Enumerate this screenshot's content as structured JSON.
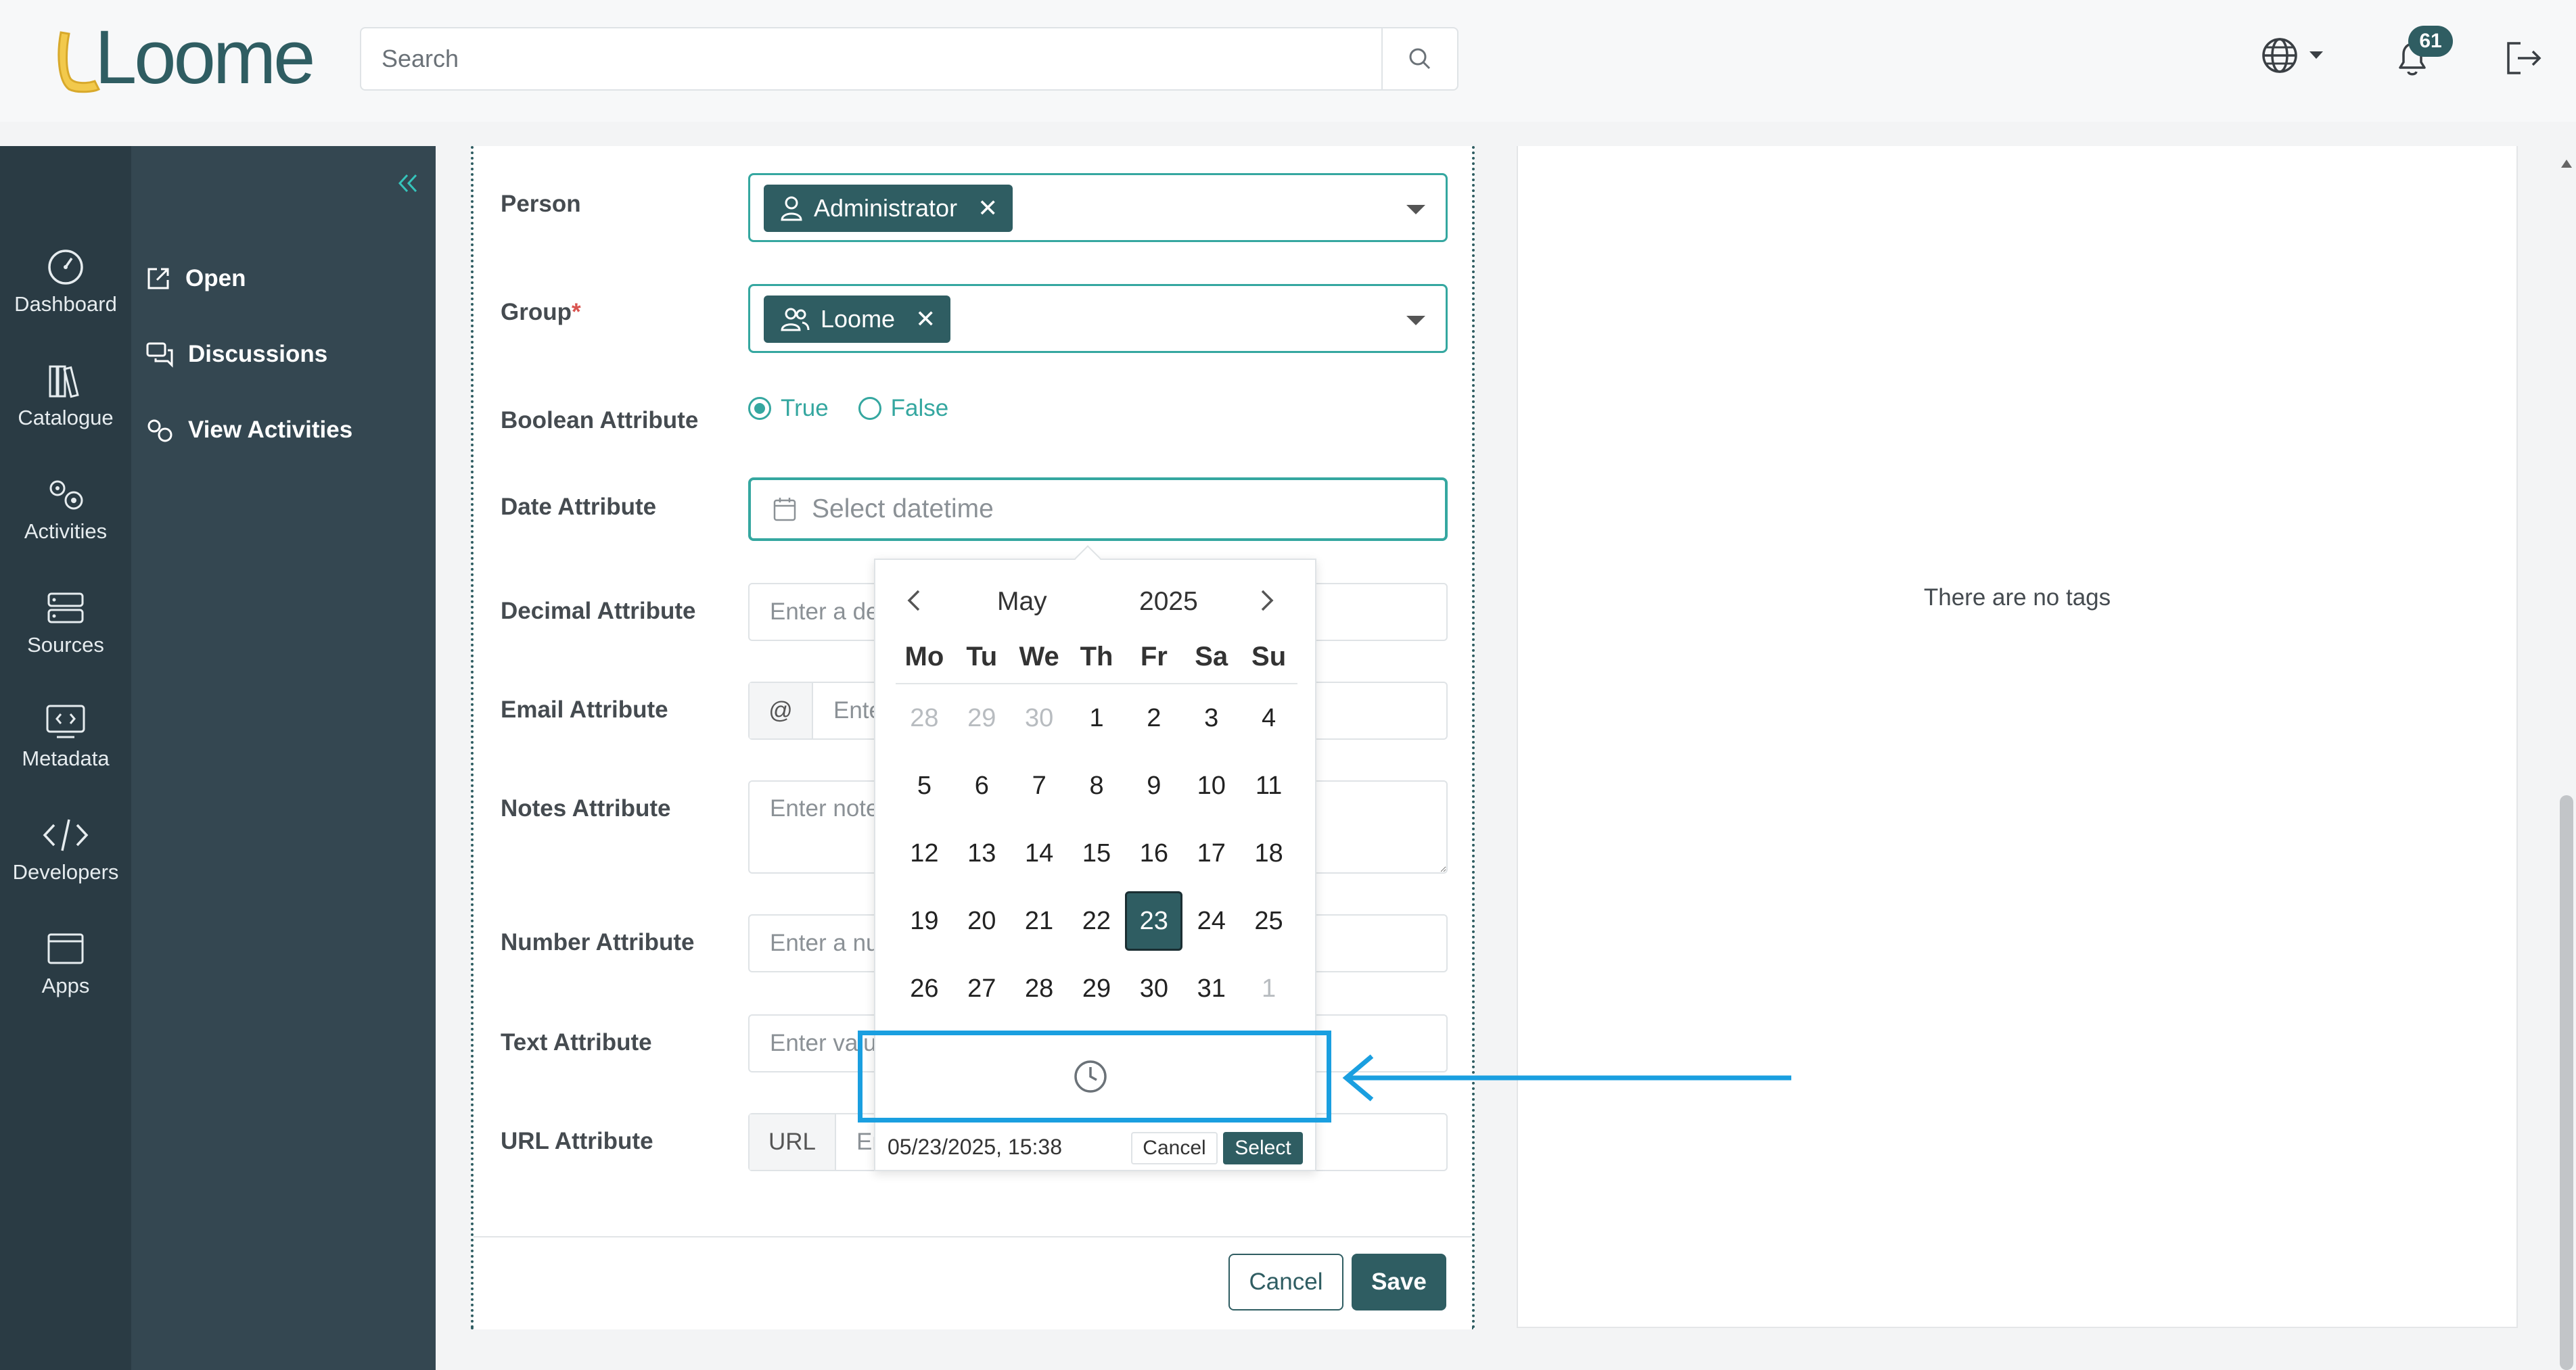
{
  "header": {
    "logo_text": "Loome",
    "search_placeholder": "Search",
    "notification_count": "61",
    "icons": {
      "search": "search-icon",
      "globe": "globe-icon",
      "bell": "bell-icon",
      "logout": "logout-icon"
    }
  },
  "rail": {
    "items": [
      {
        "label": "Dashboard",
        "icon": "dashboard-icon"
      },
      {
        "label": "Catalogue",
        "icon": "catalogue-icon"
      },
      {
        "label": "Activities",
        "icon": "activities-icon"
      },
      {
        "label": "Sources",
        "icon": "sources-icon"
      },
      {
        "label": "Metadata",
        "icon": "metadata-icon"
      },
      {
        "label": "Developers",
        "icon": "developers-icon"
      },
      {
        "label": "Apps",
        "icon": "apps-icon"
      }
    ]
  },
  "subnav": {
    "items": [
      {
        "label": "Open",
        "icon": "external-link-icon"
      },
      {
        "label": "Discussions",
        "icon": "discussions-icon"
      },
      {
        "label": "View Activities",
        "icon": "activities-icon"
      }
    ]
  },
  "form": {
    "person_label": "Person",
    "person_value": "Administrator",
    "group_label": "Group",
    "group_required": "*",
    "group_value": "Loome",
    "boolean_label": "Boolean Attribute",
    "boolean_true": "True",
    "boolean_false": "False",
    "boolean_selected": "True",
    "date_label": "Date Attribute",
    "date_placeholder": "Select datetime",
    "decimal_label": "Decimal Attribute",
    "decimal_placeholder": "Enter a decimal",
    "email_label": "Email Attribute",
    "email_addon": "@",
    "email_placeholder": "Enter email",
    "notes_label": "Notes Attribute",
    "notes_placeholder": "Enter notes",
    "number_label": "Number Attribute",
    "number_placeholder": "Enter a number",
    "text_label": "Text Attribute",
    "text_placeholder": "Enter value",
    "url_label": "URL Attribute",
    "url_addon": "URL",
    "url_placeholder": "Enter URL",
    "cancel_label": "Cancel",
    "save_label": "Save"
  },
  "tags": {
    "empty_text": "There are no tags"
  },
  "datepicker": {
    "month": "May",
    "year": "2025",
    "weekdays": [
      "Mo",
      "Tu",
      "We",
      "Th",
      "Fr",
      "Sa",
      "Su"
    ],
    "weeks": [
      [
        "28",
        "29",
        "30",
        "1",
        "2",
        "3",
        "4"
      ],
      [
        "5",
        "6",
        "7",
        "8",
        "9",
        "10",
        "11"
      ],
      [
        "12",
        "13",
        "14",
        "15",
        "16",
        "17",
        "18"
      ],
      [
        "19",
        "20",
        "21",
        "22",
        "23",
        "24",
        "25"
      ],
      [
        "26",
        "27",
        "28",
        "29",
        "30",
        "31",
        "1"
      ]
    ],
    "selected_day": "23",
    "current_value": "05/23/2025, 15:38",
    "cancel_label": "Cancel",
    "select_label": "Select"
  },
  "colors": {
    "brand": "#2f5d62",
    "accent": "#35a7a0",
    "annotation": "#1a9fe0"
  }
}
